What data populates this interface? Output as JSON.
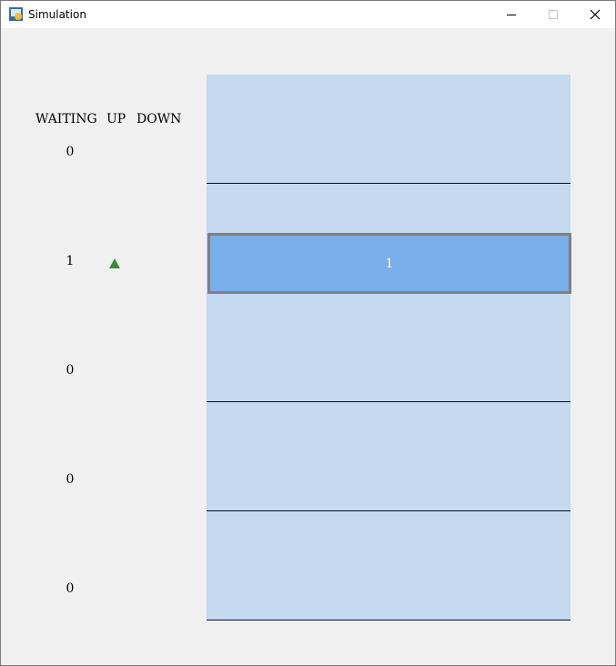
{
  "window": {
    "title": "Simulation"
  },
  "headers": {
    "waiting": "WAITING",
    "up": "UP",
    "down": "DOWN"
  },
  "floors": [
    {
      "waiting": "0",
      "up_call": false,
      "down_call": false
    },
    {
      "waiting": "1",
      "up_call": true,
      "down_call": false
    },
    {
      "waiting": "0",
      "up_call": false,
      "down_call": false
    },
    {
      "waiting": "0",
      "up_call": false,
      "down_call": false
    },
    {
      "waiting": "0",
      "up_call": false,
      "down_call": false
    }
  ],
  "elevator": {
    "label": "1",
    "floor_index": 1
  },
  "colors": {
    "shaft": "#c5d9f0",
    "car": "#78aeea",
    "car_border": "#808080",
    "up_arrow": "#3a8a3a"
  }
}
